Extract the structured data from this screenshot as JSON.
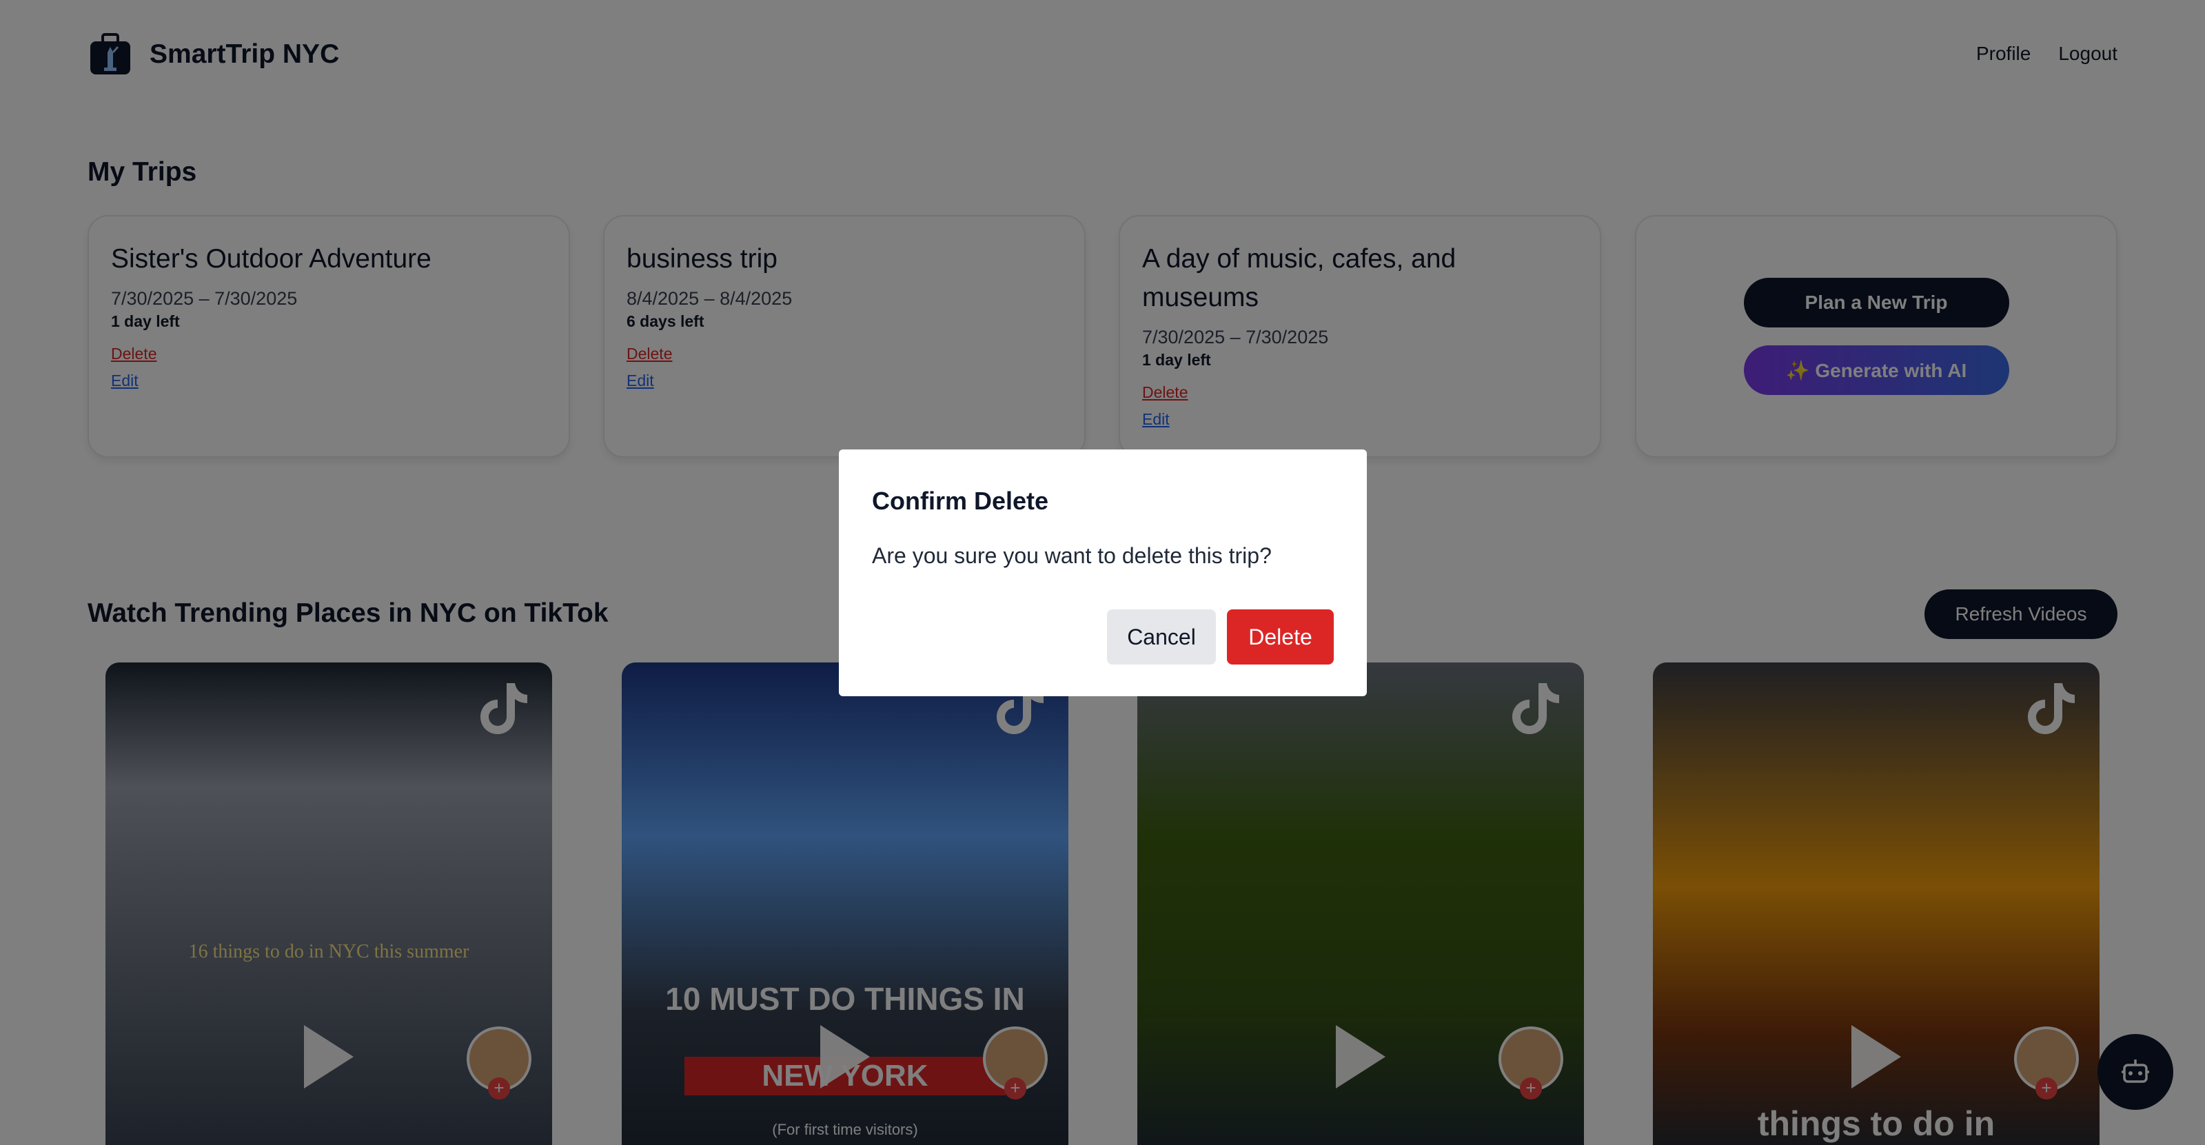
{
  "header": {
    "brand": "SmartTrip NYC",
    "nav": {
      "profile": "Profile",
      "logout": "Logout"
    }
  },
  "my_trips": {
    "title": "My Trips",
    "trips": [
      {
        "name": "Sister's Outdoor Adventure",
        "dates": "7/30/2025 – 7/30/2025",
        "days_left": "1 day left",
        "delete": "Delete",
        "edit": "Edit"
      },
      {
        "name": "business trip",
        "dates": "8/4/2025 – 8/4/2025",
        "days_left": "6 days left",
        "delete": "Delete",
        "edit": "Edit"
      },
      {
        "name": "A day of music, cafes, and museums",
        "dates": "7/30/2025 – 7/30/2025",
        "days_left": "1 day left",
        "delete": "Delete",
        "edit": "Edit"
      }
    ],
    "plan_button": "Plan a New Trip",
    "ai_button": "✨ Generate with AI"
  },
  "tiktok": {
    "title": "Watch Trending Places in NYC on TikTok",
    "refresh_button": "Refresh Videos",
    "videos": [
      {
        "caption": "16 things to do in NYC this summer"
      },
      {
        "caption_top": "10 MUST DO THINGS IN",
        "caption_mid": "NEW YORK",
        "caption_bottom": "(For first time visitors)"
      },
      {
        "caption": ""
      },
      {
        "caption": "things to do in"
      }
    ]
  },
  "modal": {
    "title": "Confirm Delete",
    "message": "Are you sure you want to delete this trip?",
    "cancel": "Cancel",
    "delete": "Delete"
  },
  "colors": {
    "primary": "#0f172a",
    "danger": "#dc2626",
    "link": "#2563eb",
    "ai_gradient_start": "#7c3aed",
    "ai_gradient_end": "#3b6be6",
    "overlay": "rgba(0,0,0,0.5)"
  },
  "icons": [
    "suitcase-statue-logo-icon",
    "tiktok-icon",
    "play-icon",
    "robot-icon"
  ]
}
